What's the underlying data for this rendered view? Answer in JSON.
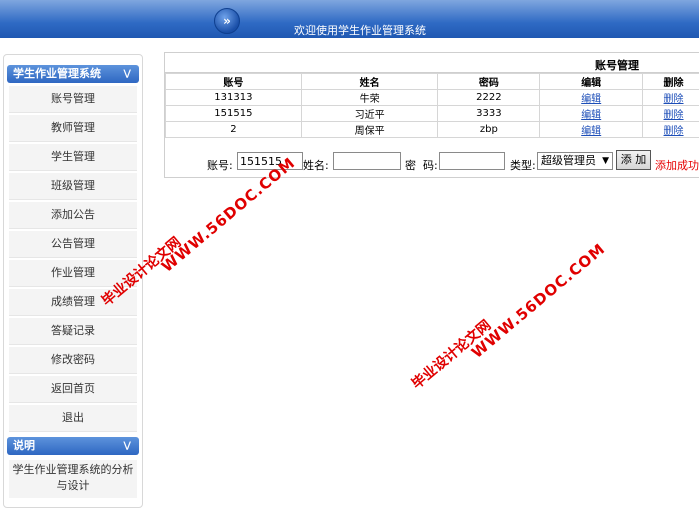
{
  "header": {
    "title": "欢迎使用学生作业管理系统",
    "arrow_icon": "»"
  },
  "sidebar": {
    "section_title": "学生作业管理系统",
    "items": [
      {
        "label": "账号管理"
      },
      {
        "label": "教师管理"
      },
      {
        "label": "学生管理"
      },
      {
        "label": "班级管理"
      },
      {
        "label": "添加公告"
      },
      {
        "label": "公告管理"
      },
      {
        "label": "作业管理"
      },
      {
        "label": "成绩管理"
      },
      {
        "label": "答疑记录"
      },
      {
        "label": "修改密码"
      },
      {
        "label": "返回首页"
      },
      {
        "label": "退出"
      }
    ],
    "desc_title": "说明",
    "desc_text": "学生作业管理系统的分析与设计"
  },
  "panel": {
    "title": "账号管理",
    "columns": [
      "账号",
      "姓名",
      "密码",
      "编辑",
      "删除"
    ],
    "rows": [
      {
        "account": "131313",
        "name": "牛荣",
        "password": "2222",
        "edit": "编辑",
        "delete": "删除"
      },
      {
        "account": "151515",
        "name": "习近平",
        "password": "3333",
        "edit": "编辑",
        "delete": "删除"
      },
      {
        "account": "2",
        "name": "周保平",
        "password": "zbp",
        "edit": "编辑",
        "delete": "删除"
      }
    ]
  },
  "form": {
    "account_label": "账号:",
    "account_value": "151515",
    "name_label": "姓名:",
    "name_value": "",
    "password_label": "密  码:",
    "password_value": "",
    "type_label": "类型:",
    "type_value": "超级管理员",
    "add_label": "添 加",
    "message": "添加成功!"
  },
  "watermark": {
    "text1": "毕业设计论文网",
    "text2": "WWW.56DOC.COM"
  },
  "colors": {
    "header": "#2f6ac4",
    "accent": "#1d4eb8",
    "success_message": "#e60000",
    "watermark": "#e00000"
  }
}
